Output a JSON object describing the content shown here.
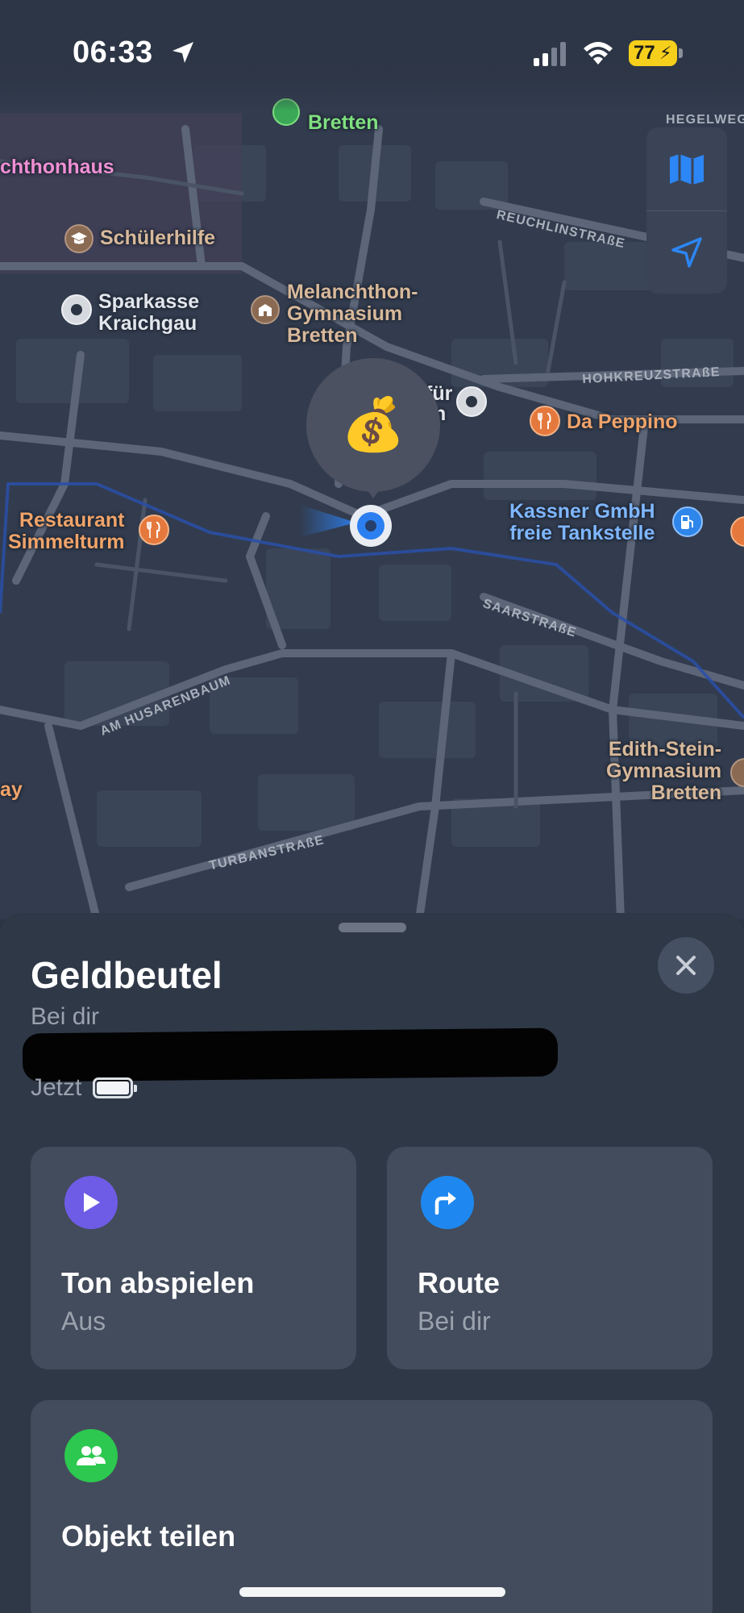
{
  "status_bar": {
    "time": "06:33",
    "battery": "77"
  },
  "map": {
    "labels": {
      "bretten_top": "Bretten",
      "melanchthonhaus": "chthonhaus",
      "hegelweg": "HEGELWEG",
      "schuelerhilfe": "Schülerhilfe",
      "sparkasse": "Sparkasse\nKraichgau",
      "gymnasium": "Melanchthon-\nGymnasium\nBretten",
      "fur_partial": "für",
      "n_partial": "n",
      "da_peppino": "Da Peppino",
      "restaurant": "Restaurant\nSimmelturm",
      "kassner": "Kassner GmbH\nfreie Tankstelle",
      "edith": "Edith-Stein-\nGymnasium\nBretten",
      "ay_partial": "ay"
    },
    "streets": {
      "reuchlin": "REUCHLINSTRAßE",
      "hohkreuz": "HOHKREUZSTRAßE",
      "saar": "SAARSTRAßE",
      "husarenbaum": "AM HUSARENBAUM",
      "turban": "TURBANSTRAßE"
    },
    "pin_emoji": "💰"
  },
  "item": {
    "title": "Geldbeutel",
    "subtitle": "Bei dir",
    "last_seen": "Jetzt"
  },
  "actions": {
    "sound": {
      "title": "Ton abspielen",
      "subtitle": "Aus"
    },
    "route": {
      "title": "Route",
      "subtitle": "Bei dir"
    },
    "share": {
      "title": "Objekt teilen"
    }
  },
  "colors": {
    "map_bg": "#323c4e",
    "sheet_bg": "#2f3847",
    "card_bg": "#434c5c",
    "sound_icon": "#6e5ce6",
    "route_icon": "#1e88f0",
    "share_icon": "#2cc84f",
    "accent_blue": "#2c7ff0"
  }
}
